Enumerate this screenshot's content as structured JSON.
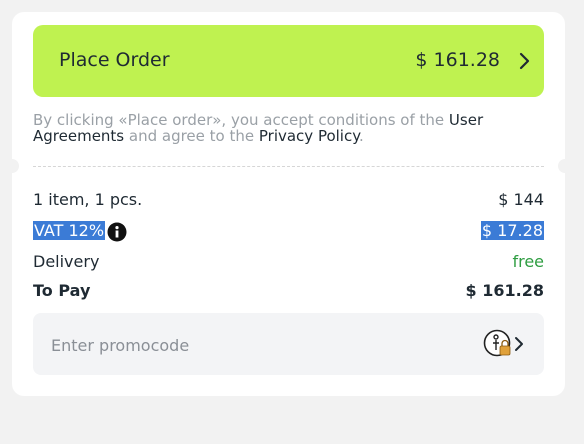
{
  "order": {
    "button_label": "Place Order",
    "price": "$ 161.28"
  },
  "terms": {
    "prefix": "By clicking «Place order», you accept conditions of the ",
    "link1": "User Agreements",
    "middle": " and agree to the ",
    "link2": "Privacy Policy",
    "suffix": "."
  },
  "summary": {
    "items_label": "1 item, 1 pcs.",
    "items_value": "$ 144",
    "vat_label": "VAT 12%",
    "vat_value": "$ 17.28",
    "delivery_label": "Delivery",
    "delivery_value": "free",
    "total_label": "To Pay",
    "total_value": "$ 161.28"
  },
  "promo": {
    "placeholder": "Enter promocode",
    "icon": "promo-lock-icon"
  },
  "colors": {
    "accent": "#bff250",
    "free": "#2e9d41",
    "selection": "#3b7bd6"
  }
}
